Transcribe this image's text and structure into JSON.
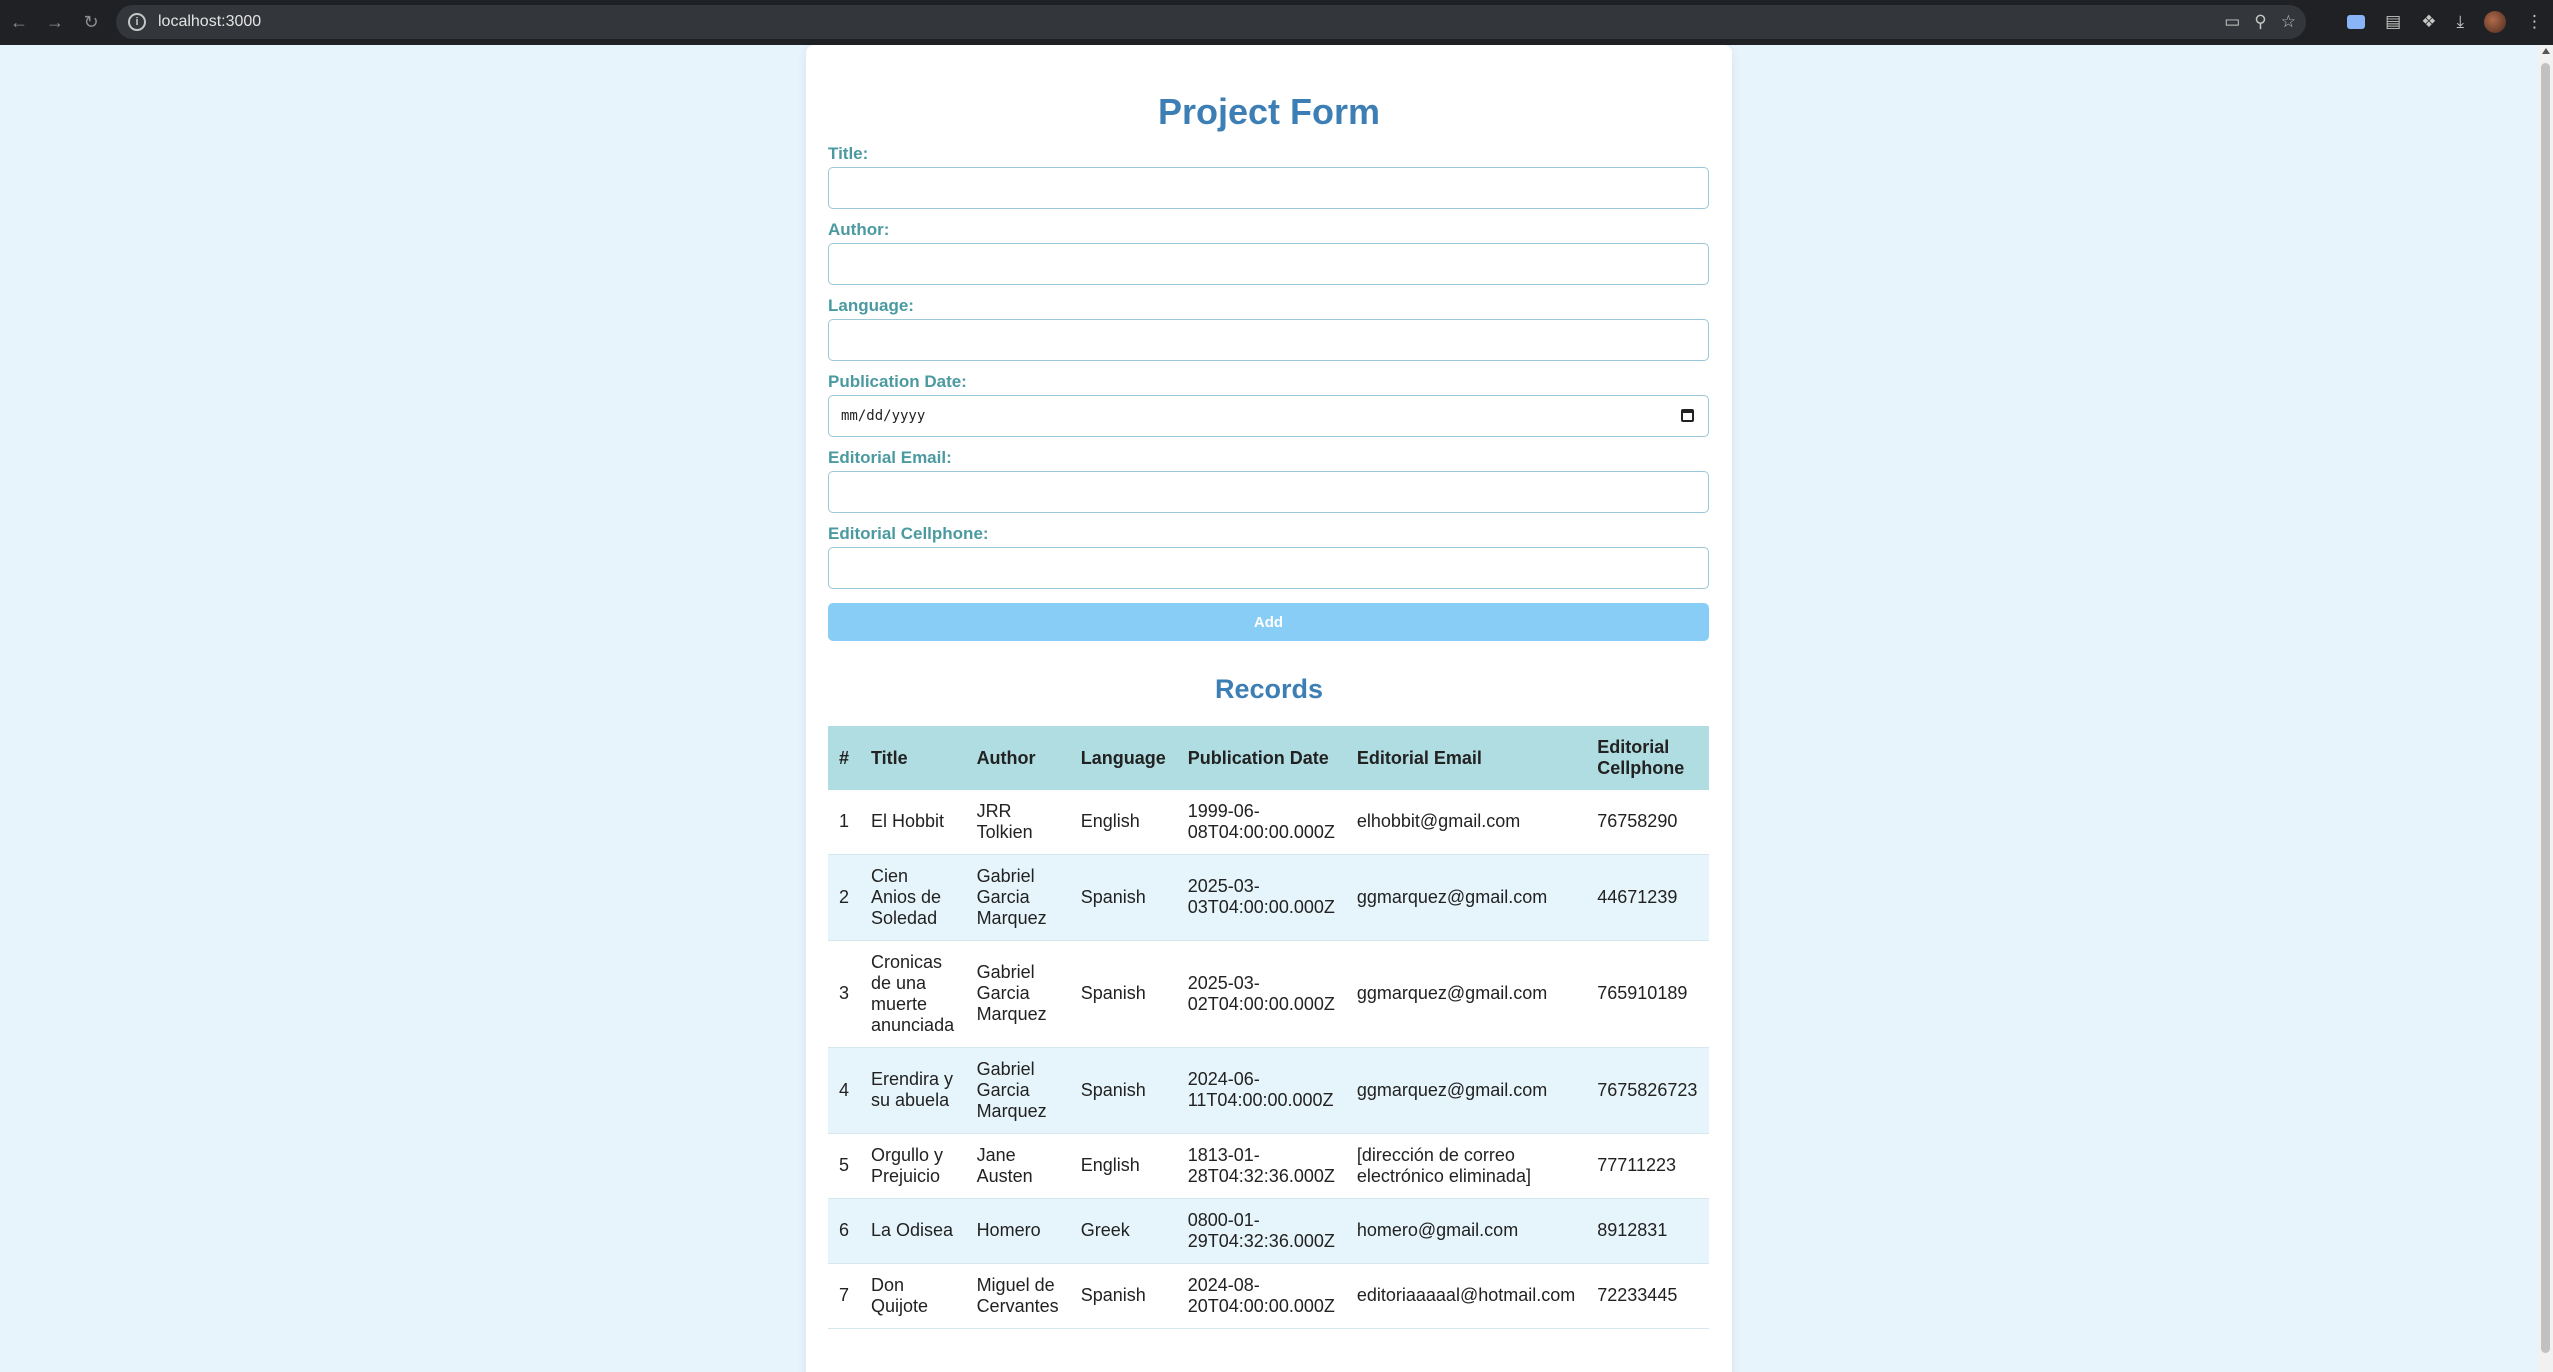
{
  "browser": {
    "url": "localhost:3000"
  },
  "form": {
    "title": "Project Form",
    "fields": [
      {
        "label": "Title:",
        "value": ""
      },
      {
        "label": "Author:",
        "value": ""
      },
      {
        "label": "Language:",
        "value": ""
      },
      {
        "label": "Publication Date:",
        "value": "mm/dd/yyyy"
      },
      {
        "label": "Editorial Email:",
        "value": ""
      },
      {
        "label": "Editorial Cellphone:",
        "value": ""
      }
    ],
    "add_label": "Add"
  },
  "records": {
    "title": "Records",
    "columns": [
      "#",
      "Title",
      "Author",
      "Language",
      "Publication Date",
      "Editorial Email",
      "Editorial Cellphone"
    ],
    "rows": [
      [
        "1",
        "El Hobbit",
        "JRR Tolkien",
        "English",
        "1999-06-08T04:00:00.000Z",
        "elhobbit@gmail.com",
        "76758290"
      ],
      [
        "2",
        "Cien Anios de Soledad",
        "Gabriel Garcia Marquez",
        "Spanish",
        "2025-03-03T04:00:00.000Z",
        "ggmarquez@gmail.com",
        "44671239"
      ],
      [
        "3",
        "Cronicas de una muerte anunciada",
        "Gabriel Garcia Marquez",
        "Spanish",
        "2025-03-02T04:00:00.000Z",
        "ggmarquez@gmail.com",
        "765910189"
      ],
      [
        "4",
        "Erendira y su abuela",
        "Gabriel Garcia Marquez",
        "Spanish",
        "2024-06-11T04:00:00.000Z",
        "ggmarquez@gmail.com",
        "7675826723"
      ],
      [
        "5",
        "Orgullo y Prejuicio",
        "Jane Austen",
        "English",
        "1813-01-28T04:32:36.000Z",
        "[dirección de correo electrónico eliminada]",
        "77711223"
      ],
      [
        "6",
        "La Odisea",
        "Homero",
        "Greek",
        "0800-01-29T04:32:36.000Z",
        "homero@gmail.com",
        "8912831"
      ],
      [
        "7",
        "Don Quijote",
        "Miguel de Cervantes",
        "Spanish",
        "2024-08-20T04:00:00.000Z",
        "editoriaaaaal@hotmail.com",
        "72233445"
      ]
    ]
  },
  "colors": {
    "accent": "#3d7fb5",
    "label": "#4a9aa0",
    "button": "#87cdf6",
    "table_header": "#b0dde2",
    "page_bg": "#e8f4fc"
  }
}
